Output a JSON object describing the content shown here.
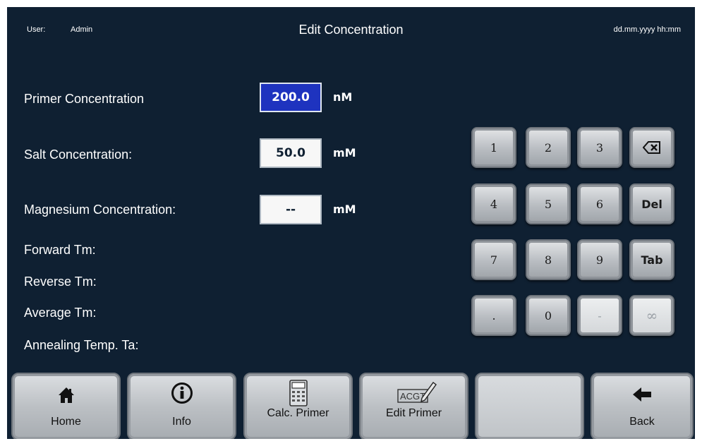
{
  "header": {
    "user_label": "User:",
    "user_value": "Admin",
    "title": "Edit Concentration",
    "datetime": "dd.mm.yyyy  hh:mm"
  },
  "fields": {
    "primer": {
      "label": "Primer Concentration",
      "value": "200.0",
      "unit": "nM"
    },
    "salt": {
      "label": "Salt Concentration:",
      "value": "50.0",
      "unit": "mM"
    },
    "magnesium": {
      "label": "Magnesium Concentration:",
      "value": "--",
      "unit": "mM"
    }
  },
  "results": {
    "forward_tm": "Forward Tm:",
    "reverse_tm": "Reverse Tm:",
    "average_tm": "Average Tm:",
    "annealing": "Annealing Temp. Ta:"
  },
  "keypad": {
    "k1": "1",
    "k2": "2",
    "k3": "3",
    "k4": "4",
    "k5": "5",
    "k6": "6",
    "k7": "7",
    "k8": "8",
    "k9": "9",
    "dot": ".",
    "k0": "0",
    "minus": "-",
    "del": "Del",
    "tab": "Tab",
    "infinity": "∞",
    "backspace_icon": "backspace-icon"
  },
  "nav": {
    "home": "Home",
    "info": "Info",
    "calc_primer": "Calc. Primer",
    "edit_primer": "Edit Primer",
    "edit_primer_icon_text": "ACGT",
    "back": "Back"
  },
  "colors": {
    "background": "#0f2032",
    "active_field": "#1e33bf",
    "button_silver": "#bcc0c4"
  }
}
